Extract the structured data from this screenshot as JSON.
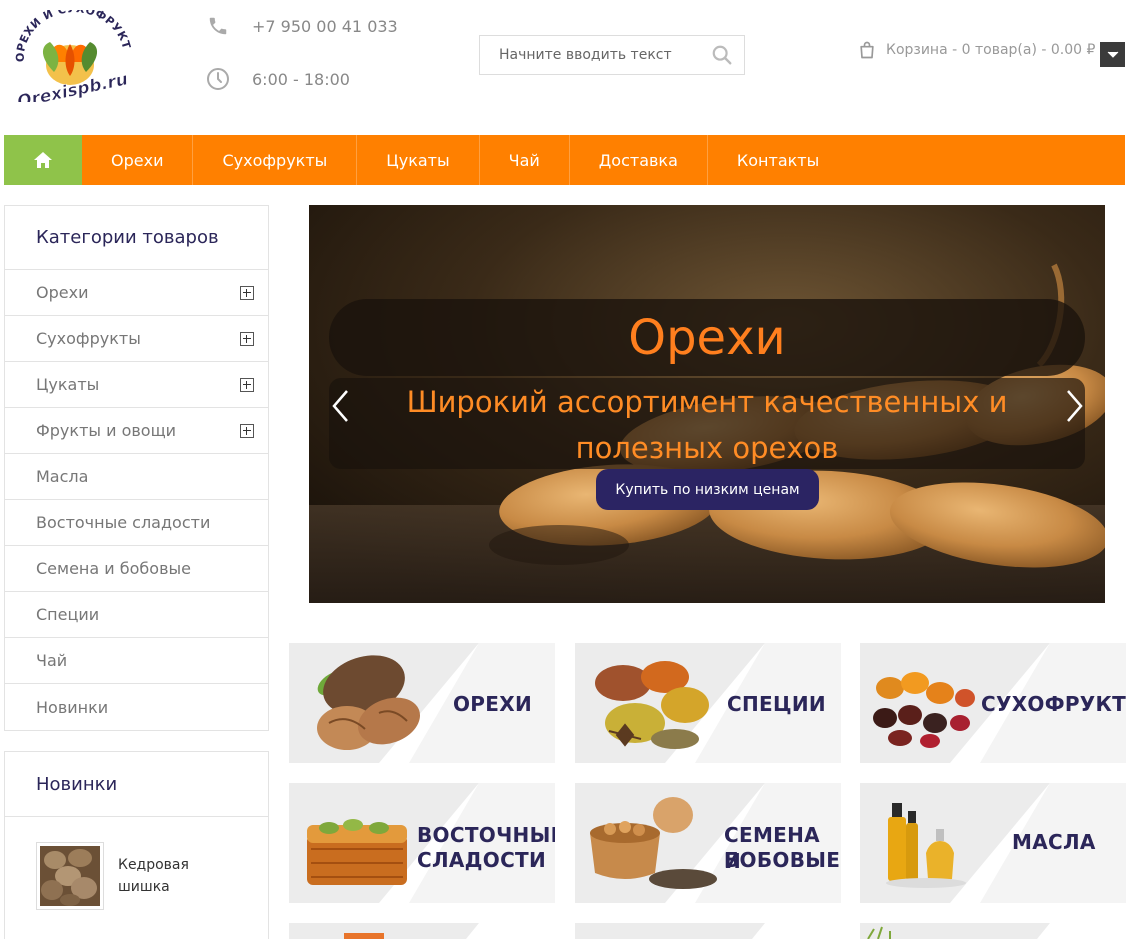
{
  "header": {
    "logo_text_top": "ОРЕХИ И СУХОФРУКТЫ",
    "logo_text_main": "Orexispb.ru",
    "phone": "+7 950 00 41 033",
    "hours": "6:00 - 18:00",
    "search_placeholder": "Начните вводить текст",
    "cart_label": "Корзина - 0 товар(а) - 0.00 ₽"
  },
  "nav": {
    "items": [
      {
        "label": "Орехи"
      },
      {
        "label": "Сухофрукты"
      },
      {
        "label": "Цукаты"
      },
      {
        "label": "Чай"
      },
      {
        "label": "Доставка"
      },
      {
        "label": "Контакты"
      }
    ]
  },
  "sidebar": {
    "categories_title": "Категории товаров",
    "categories": [
      {
        "label": "Орехи",
        "expandable": true
      },
      {
        "label": "Сухофрукты",
        "expandable": true
      },
      {
        "label": "Цукаты",
        "expandable": true
      },
      {
        "label": "Фрукты и овощи",
        "expandable": true
      },
      {
        "label": "Масла",
        "expandable": false
      },
      {
        "label": "Восточные сладости",
        "expandable": false
      },
      {
        "label": "Семена и бобовые",
        "expandable": false
      },
      {
        "label": "Специи",
        "expandable": false
      },
      {
        "label": "Чай",
        "expandable": false
      },
      {
        "label": "Новинки",
        "expandable": false
      }
    ],
    "new_title": "Новинки",
    "new_products": [
      {
        "name": "Кедровая шишка"
      }
    ]
  },
  "slider": {
    "title": "Орехи",
    "description": "Широкий ассортимент качественных и полезных орехов",
    "button": "Купить по низким ценам"
  },
  "tiles": [
    {
      "label_line1": "ОРЕХИ",
      "label_line2": ""
    },
    {
      "label_line1": "СПЕЦИИ",
      "label_line2": ""
    },
    {
      "label_line1": "СУХОФРУКТЫ",
      "label_line2": ""
    },
    {
      "label_line1": "ВОСТОЧНЫЕ",
      "label_line2": "СЛАДОСТИ"
    },
    {
      "label_line1": "СЕМЕНА И",
      "label_line2": "БОБОВЫЕ"
    },
    {
      "label_line1": "МАСЛА",
      "label_line2": ""
    }
  ],
  "colors": {
    "accent_orange": "#ff8000",
    "home_green": "#8fc34a",
    "navy": "#2b2659",
    "button_purple": "#2b2463"
  }
}
